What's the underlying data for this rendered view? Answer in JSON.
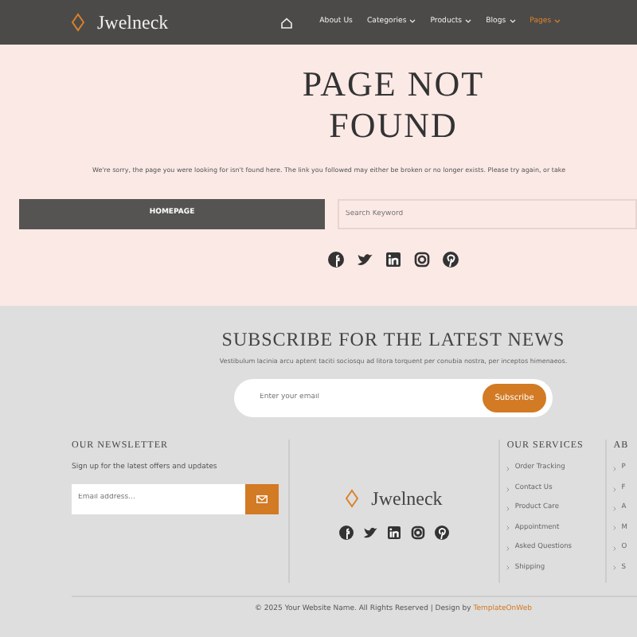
{
  "navbar": {
    "brand": "Jwelneck",
    "items": [
      {
        "kind": "home"
      },
      {
        "kind": "link",
        "label": "About Us",
        "dropdown": false,
        "selected": false
      },
      {
        "kind": "link",
        "label": "Categories",
        "dropdown": true,
        "selected": false
      },
      {
        "kind": "link",
        "label": "Products",
        "dropdown": true,
        "selected": false
      },
      {
        "kind": "link",
        "label": "Blogs",
        "dropdown": true,
        "selected": false
      },
      {
        "kind": "link",
        "label": "Pages",
        "dropdown": true,
        "selected": true
      }
    ]
  },
  "hero": {
    "title": "PAGE NOT FOUND",
    "message": "We're sorry, the page you were looking for isn't found here. The link you followed may either be broken or no longer exists. Please try again, or take",
    "button": "HOMEPAGE",
    "search": {
      "placeholder": "Search Keyword"
    }
  },
  "subscribe": {
    "title": "SUBSCRIBE FOR THE LATEST NEWS",
    "text": "Vestibulum lacinia arcu aptent taciti sociosqu ad litora torquent per conubia nostra, per inceptos himenaeos.",
    "email": {
      "placeholder": "Enter your email"
    },
    "button": "Subscribe"
  },
  "footer": {
    "newsletter": {
      "title": "OUR NEWSLETTER",
      "text": "Sign up for the latest offers and updates",
      "email": {
        "placeholder": "Email address..."
      }
    },
    "brand": "Jwelneck",
    "columns": [
      {
        "title": "OUR SERVICES",
        "items": [
          "Order Tracking",
          "Contact Us",
          "Product Care",
          "Appointment",
          "Asked Questions",
          "Shipping"
        ]
      },
      {
        "title": "AB",
        "items": [
          "P",
          "F",
          "A",
          "M",
          "O",
          "S"
        ]
      }
    ],
    "copyright": "© 2025 Your Website Name. All Rights Reserved | Design by ",
    "credit": "TemplateOnWeb"
  }
}
